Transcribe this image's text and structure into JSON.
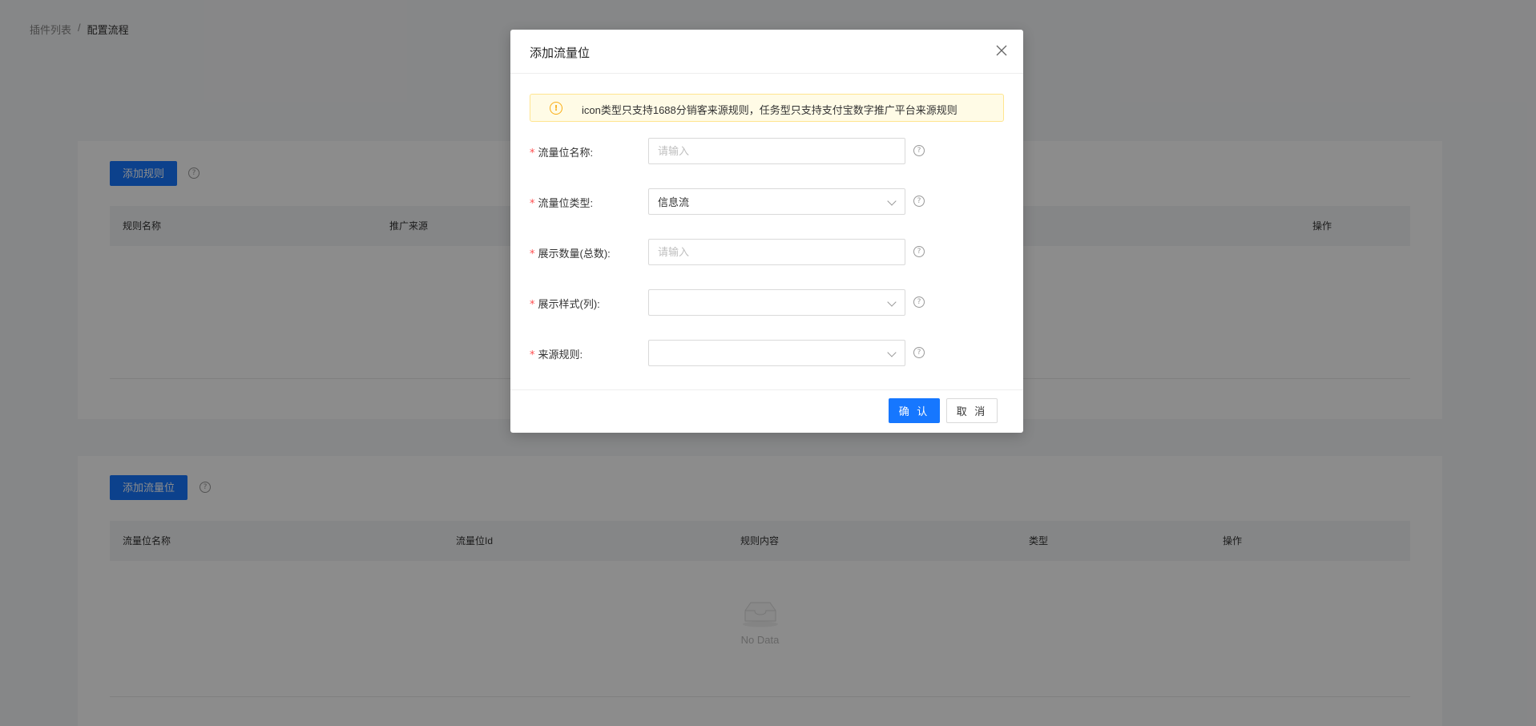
{
  "breadcrumb": {
    "items": [
      "插件列表",
      "配置流程"
    ],
    "separator": "/"
  },
  "rules_card": {
    "add_button": "添加规则",
    "columns": [
      "规则名称",
      "推广来源",
      "操作"
    ]
  },
  "slots_card": {
    "add_button": "添加流量位",
    "columns": [
      "流量位名称",
      "流量位Id",
      "规则内容",
      "类型",
      "操作"
    ],
    "empty_text": "No Data"
  },
  "modal": {
    "title": "添加流量位",
    "alert": "icon类型只支持1688分销客来源规则，任务型只支持支付宝数字推广平台来源规则",
    "fields": [
      {
        "label": "流量位名称:",
        "type": "input",
        "placeholder": "请输入",
        "value": ""
      },
      {
        "label": "流量位类型:",
        "type": "select",
        "value": "信息流"
      },
      {
        "label": "展示数量(总数):",
        "type": "input",
        "placeholder": "请输入",
        "value": ""
      },
      {
        "label": "展示样式(列):",
        "type": "select",
        "value": ""
      },
      {
        "label": "来源规则:",
        "type": "select",
        "value": ""
      }
    ],
    "required_mark": "*",
    "confirm": "确 认",
    "cancel": "取 消"
  },
  "colors": {
    "primary": "#1677ff",
    "required": "#ff4d4f",
    "warning": "#faad14",
    "mask": "rgba(0,0,0,0.45)"
  },
  "icons": {
    "help": "question-circle-icon",
    "close": "close-icon",
    "warning": "exclamation-circle-icon",
    "chevron": "chevron-down-icon",
    "empty": "empty-inbox-icon"
  }
}
